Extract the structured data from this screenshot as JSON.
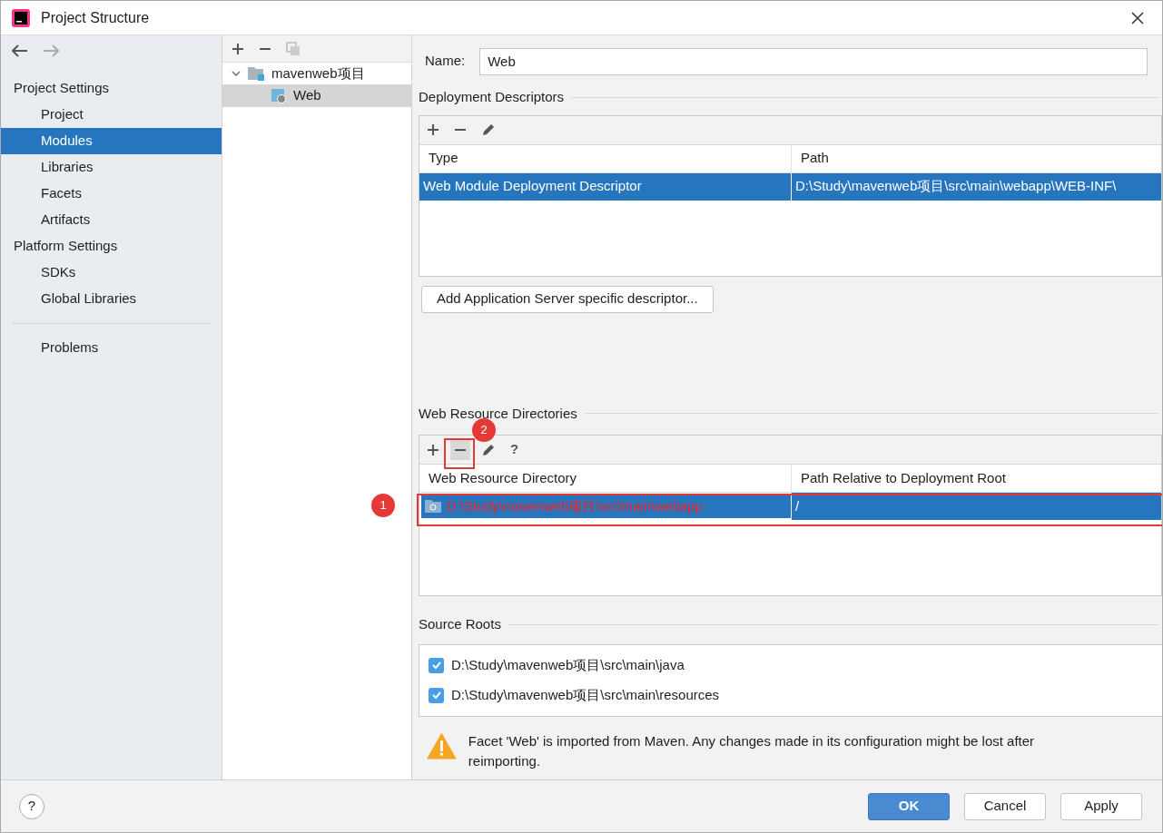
{
  "window": {
    "title": "Project Structure"
  },
  "sidebar": {
    "sections": [
      {
        "title": "Project Settings",
        "items": [
          {
            "label": "Project",
            "selected": false
          },
          {
            "label": "Modules",
            "selected": true
          },
          {
            "label": "Libraries",
            "selected": false
          },
          {
            "label": "Facets",
            "selected": false
          },
          {
            "label": "Artifacts",
            "selected": false
          }
        ]
      },
      {
        "title": "Platform Settings",
        "items": [
          {
            "label": "SDKs",
            "selected": false
          },
          {
            "label": "Global Libraries",
            "selected": false
          }
        ]
      }
    ],
    "extra_items": [
      {
        "label": "Problems",
        "selected": false
      }
    ]
  },
  "tree": {
    "items": [
      {
        "label": "mavenweb项目",
        "expanded": true,
        "selected": false,
        "children": [
          {
            "label": "Web",
            "selected": true
          }
        ]
      }
    ]
  },
  "name_field": {
    "label": "Name:",
    "value": "Web"
  },
  "deployment_descriptors": {
    "title": "Deployment Descriptors",
    "columns": [
      "Type",
      "Path"
    ],
    "rows": [
      {
        "cells": [
          "Web Module Deployment Descriptor",
          "D:\\Study\\mavenweb项目\\src\\main\\webapp\\WEB-INF\\"
        ],
        "selected": true
      }
    ],
    "add_button": "Add Application Server specific descriptor..."
  },
  "web_resource_directories": {
    "title": "Web Resource Directories",
    "columns": [
      "Web Resource Directory",
      "Path Relative to Deployment Root"
    ],
    "rows": [
      {
        "cells": [
          "D:\\Study\\mavenweb项目\\src\\main\\webapp",
          "/"
        ],
        "selected": true
      }
    ],
    "help": "?"
  },
  "source_roots": {
    "title": "Source Roots",
    "items": [
      {
        "label": "D:\\Study\\mavenweb项目\\src\\main\\java",
        "checked": true
      },
      {
        "label": "D:\\Study\\mavenweb项目\\src\\main\\resources",
        "checked": true
      }
    ]
  },
  "warning": "Facet 'Web' is imported from Maven. Any changes made in its configuration might be lost after reimporting.",
  "annotations": [
    "1",
    "2"
  ],
  "buttons": [
    {
      "label": "OK",
      "kind": "primary"
    },
    {
      "label": "Cancel",
      "kind": "normal"
    },
    {
      "label": "Apply",
      "kind": "normal"
    }
  ],
  "help_button": "?"
}
